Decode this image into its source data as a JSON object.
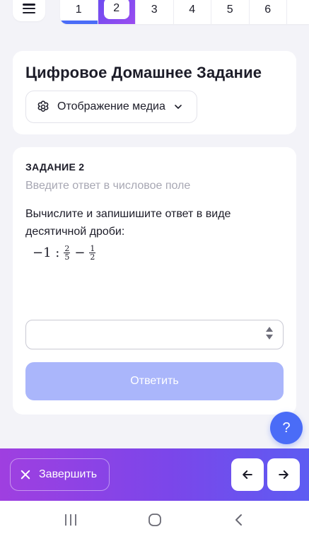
{
  "tabs": [
    "1",
    "2",
    "3",
    "4",
    "5",
    "6"
  ],
  "header": {
    "title": "Цифровое Домашнее Задание",
    "media_label": "Отображение медиа"
  },
  "task": {
    "label": "ЗАДАНИЕ 2",
    "hint": "Введите ответ в числовое поле",
    "question": "Вычислите и запишишите ответ в виде десятичной дроби:",
    "formula": {
      "lead": "−1 :",
      "frac1_num": "2",
      "frac1_den": "5",
      "op": "−",
      "frac2_num": "1",
      "frac2_den": "2"
    },
    "answer_value": "",
    "submit_label": "Ответить"
  },
  "help_label": "?",
  "footer": {
    "finish_label": "Завершить"
  },
  "colors": {
    "accent": "#4a6cf7",
    "submit_disabled": "#aab6fb",
    "bar_gradient_start": "#9f3fe0",
    "bar_gradient_end": "#5d5cf2"
  }
}
